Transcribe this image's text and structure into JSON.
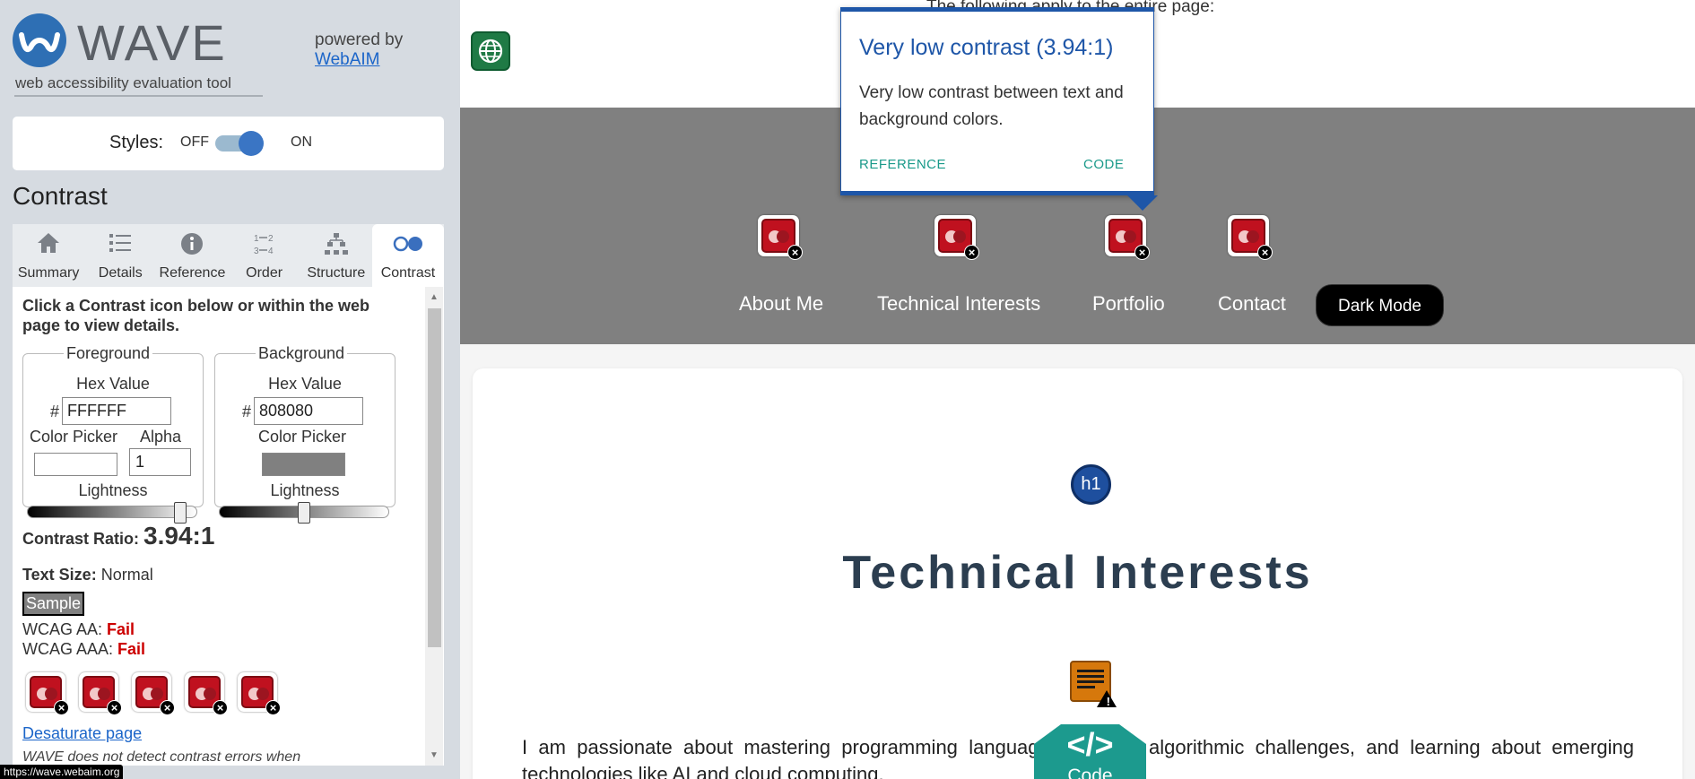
{
  "wave": {
    "logo_word": "WAVE",
    "tagline": "web accessibility evaluation tool",
    "powered_by": "powered by",
    "powered_link": "WebAIM",
    "styles_label": "Styles:",
    "styles_off": "OFF",
    "styles_on": "ON",
    "styles_state": "on",
    "section_title": "Contrast",
    "tabs": [
      {
        "label": "Summary",
        "icon": "home-icon"
      },
      {
        "label": "Details",
        "icon": "list-icon"
      },
      {
        "label": "Reference",
        "icon": "info-icon"
      },
      {
        "label": "Order",
        "icon": "order-icon"
      },
      {
        "label": "Structure",
        "icon": "structure-icon"
      },
      {
        "label": "Contrast",
        "icon": "contrast-icon",
        "active": true
      }
    ],
    "instructions": "Click a Contrast icon below or within the web page to view details.",
    "foreground": {
      "legend": "Foreground",
      "hex_label": "Hex Value",
      "hash": "#",
      "hex": "FFFFFF",
      "picker_label": "Color Picker",
      "alpha_label": "Alpha",
      "alpha": "1",
      "lightness_label": "Lightness",
      "color": "#ffffff",
      "lightness": 0.93
    },
    "background": {
      "legend": "Background",
      "hex_label": "Hex Value",
      "hash": "#",
      "hex": "808080",
      "picker_label": "Color Picker",
      "lightness_label": "Lightness",
      "color": "#808080",
      "lightness": 0.5
    },
    "contrast_ratio_label": "Contrast Ratio:",
    "contrast_ratio": "3.94:1",
    "text_size_label": "Text Size:",
    "text_size": "Normal",
    "sample": "Sample",
    "wcag_aa_label": "WCAG AA:",
    "wcag_aa": "Fail",
    "wcag_aaa_label": "WCAG AAA:",
    "wcag_aaa": "Fail",
    "contrast_error_count": 5,
    "desaturate_link": "Desaturate page",
    "note": "WAVE does not detect contrast errors when"
  },
  "status_url": "https://wave.webaim.org",
  "page": {
    "top_text": "The following apply to the entire page:",
    "nav": [
      "About Me",
      "Technical Interests",
      "Portfolio",
      "Contact"
    ],
    "dark_mode": "Dark Mode",
    "popup": {
      "title": "Very low contrast (3.94:1)",
      "body": "Very low contrast between text and background colors.",
      "reference": "REFERENCE",
      "code": "CODE"
    },
    "h1_badge": "h1",
    "title": "Technical Interests",
    "paragraph": "I am passionate about mastering programming languages, solving algorithmic challenges, and learning about emerging technologies like AI and cloud computing.",
    "code_button": {
      "symbol": "</>",
      "label": "Code"
    }
  },
  "colors": {
    "wave_blue": "#1e56a8",
    "error_red": "#c0111f",
    "fail_red": "#cc0000",
    "nav_bg": "#808080",
    "title": "#2c3e50",
    "code_teal": "#1a9a8a"
  }
}
